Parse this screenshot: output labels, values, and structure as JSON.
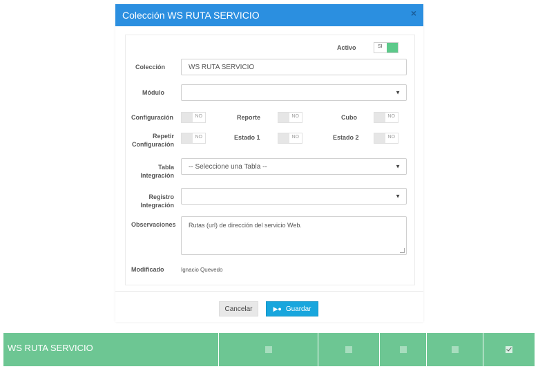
{
  "modal": {
    "title": "Colección WS RUTA SERVICIO",
    "close": "×"
  },
  "form": {
    "activo": {
      "label": "Activo",
      "state": "SI"
    },
    "coleccion": {
      "label": "Colección",
      "value": "WS RUTA SERVICIO"
    },
    "modulo": {
      "label": "Módulo",
      "value": ""
    },
    "toggles": {
      "configuracion": {
        "label": "Configuración",
        "state": "NO"
      },
      "reporte": {
        "label": "Reporte",
        "state": "NO"
      },
      "cubo": {
        "label": "Cubo",
        "state": "NO"
      },
      "repetir_l1": "Repetir",
      "repetir_l2": "Configuración",
      "repetir_state": "NO",
      "estado1": {
        "label": "Estado 1",
        "state": "NO"
      },
      "estado2": {
        "label": "Estado 2",
        "state": "NO"
      }
    },
    "tabla": {
      "label_l1": "Tabla",
      "label_l2": "Integración",
      "value": "-- Seleccione una Tabla --"
    },
    "registro": {
      "label_l1": "Registro",
      "label_l2": "Integración",
      "value": ""
    },
    "observaciones": {
      "label": "Observaciones",
      "value": "Rutas (url) de dirección del servicio Web."
    },
    "modificado": {
      "label": "Modificado",
      "value": "Ignacio Quevedo"
    }
  },
  "buttons": {
    "cancel": "Cancelar",
    "save": "Guardar"
  },
  "table_row": {
    "name": "WS RUTA SERVICIO",
    "checks": [
      false,
      false,
      false,
      false,
      true
    ]
  },
  "colors": {
    "header": "#2b8fe0",
    "save": "#18a6dd",
    "row": "#6dc693",
    "toggle_on": "#5cc98a"
  }
}
